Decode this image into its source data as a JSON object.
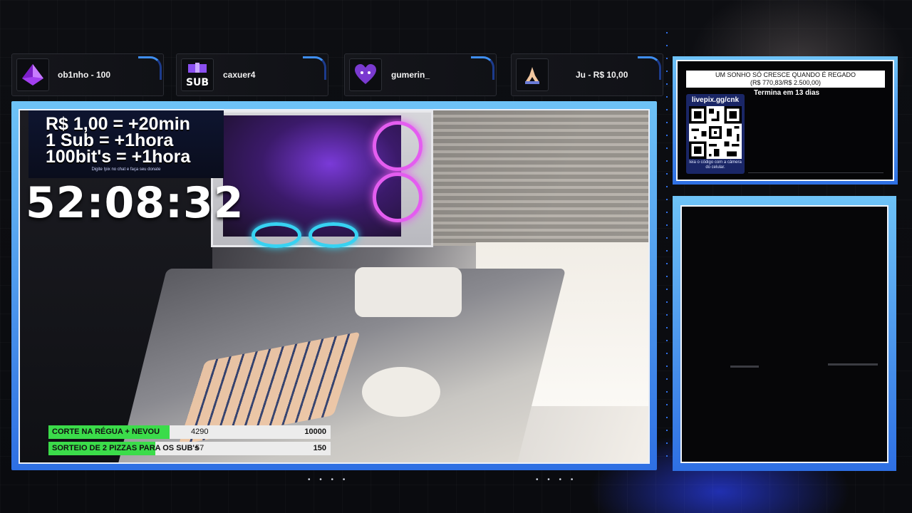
{
  "alerts": [
    {
      "name": "ob1nho - 100",
      "icon": "purple-gem-icon"
    },
    {
      "name": "caxuer4",
      "icon": "sub-gift-icon"
    },
    {
      "name": "gumerin_",
      "icon": "purple-heart-icon"
    },
    {
      "name": "Ju - R$ 10,00",
      "icon": "praying-hands-icon"
    }
  ],
  "promo": {
    "line1": "R$ 1,00 = +20min",
    "line2": "1 Sub = +1hora",
    "line3": "100bit's = +1hora",
    "hint": "Digite !pix no chat e faça seu donate"
  },
  "timer": "52:08:32",
  "goals": [
    {
      "label": "CORTE NA RÉGUA + NEVOU",
      "current": "4290",
      "target": "10000",
      "progress": 0.429
    },
    {
      "label": "SORTEIO DE 2 PIZZAS PARA OS SUB's",
      "current": "57",
      "target": "150",
      "progress": 0.38
    }
  ],
  "donation": {
    "title": "UM SONHO SÓ CRESCE QUANDO É REGADO",
    "amount": "(R$ 770,83/R$ 2.500,00)",
    "ends": "Termina em 13 dias",
    "url": "livepix.gg/cnk",
    "qr_hint": "Ieia o código com a câmera do celular."
  },
  "colors": {
    "accent_blue": "#3f8ef0",
    "goal_green": "#3bdc4a",
    "frame_gradient_top": "#6ec3f7",
    "frame_gradient_bottom": "#2e6fe3"
  }
}
